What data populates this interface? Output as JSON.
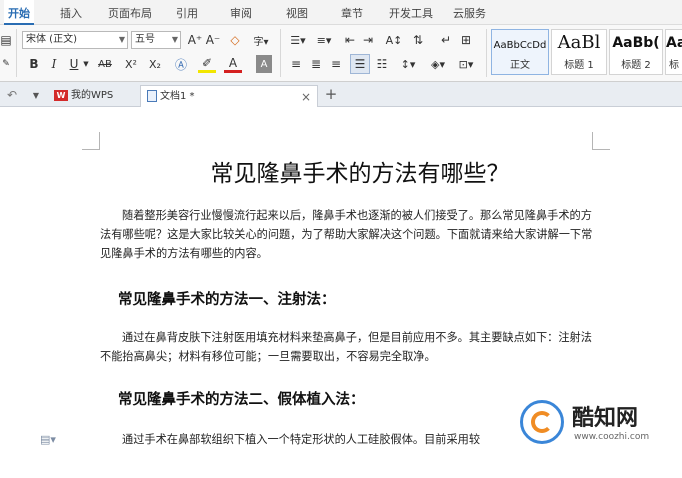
{
  "menu": {
    "tabs": [
      "开始",
      "插入",
      "页面布局",
      "引用",
      "审阅",
      "视图",
      "章节",
      "开发工具",
      "云服务"
    ]
  },
  "ribbon": {
    "font_name": "宋体 (正文)",
    "font_size": "五号",
    "grow_font": "A⁺",
    "shrink_font": "A⁻",
    "bold": "B",
    "italic": "I",
    "underline": "U",
    "strike": "AB",
    "superscript": "X²",
    "subscript": "X₂",
    "font_color": "A",
    "styles": [
      {
        "preview": "AaBbCcDd",
        "label": "正文"
      },
      {
        "preview": "AaBl",
        "label": "标题 1"
      },
      {
        "preview": "AaBb(",
        "label": "标题 2"
      },
      {
        "preview": "Aa",
        "label": "标"
      }
    ]
  },
  "tabbar": {
    "home_tab": "我的WPS",
    "doc_tab": "文档1 *",
    "close": "×",
    "add": "+"
  },
  "document": {
    "title": "常见隆鼻手术的方法有哪些？",
    "intro": "随着整形美容行业慢慢流行起来以后，隆鼻手术也逐渐的被人们接受了。那么常见隆鼻手术的方法有哪些呢？这是大家比较关心的问题，为了帮助大家解决这个问题。下面就请来给大家讲解一下常见隆鼻手术的方法有哪些的内容。",
    "heading1": "常见隆鼻手术的方法一、注射法：",
    "para1": "通过在鼻背皮肤下注射医用填充材料来垫高鼻子，但是目前应用不多。其主要缺点如下：注射法不能抬高鼻尖；材料有移位可能；一旦需要取出，不容易完全取净。",
    "heading2": "常见隆鼻手术的方法二、假体植入法：",
    "para2": "通过手术在鼻部软组织下植入一个特定形状的人工硅胶假体。目前采用较"
  },
  "watermark": {
    "name": "酷知网",
    "url": "www.coozhi.com"
  },
  "colors": {
    "accent": "#2a6db3",
    "wps_red": "#d32a2a",
    "watermark_blue": "#3a86d8",
    "watermark_orange": "#f08c24"
  }
}
